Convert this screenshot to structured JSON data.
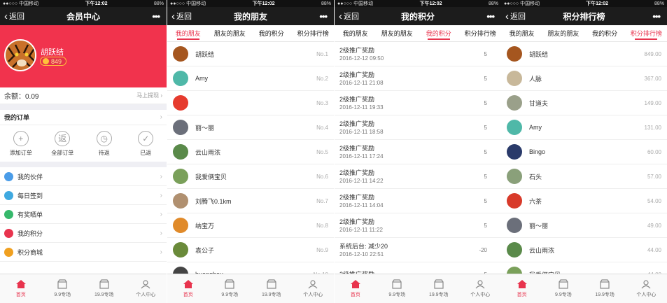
{
  "status": {
    "carrier": "●●○○○ 中国移动",
    "time": "下午12:02",
    "battery": "88%"
  },
  "common": {
    "back": "返回",
    "more": "•••"
  },
  "tabs": [
    "我的朋友",
    "朋友的朋友",
    "我的积分",
    "积分排行榜"
  ],
  "tabbar": [
    "首页",
    "9.9专场",
    "19.9专场",
    "个人中心"
  ],
  "accent": "#e8344e",
  "screen1": {
    "title": "会员中心",
    "name": "胡跃结",
    "points": "849",
    "balance_label": "余额：0.09",
    "withdraw": "马上提现",
    "orders_title": "我的订单",
    "order_actions": [
      "添加订单",
      "全部订单",
      "待返",
      "已返"
    ],
    "menu": [
      {
        "label": "我的伙伴",
        "color": "#4a9ce8"
      },
      {
        "label": "每日签到",
        "color": "#3fa9e0"
      },
      {
        "label": "有奖晒单",
        "color": "#36b86b"
      },
      {
        "label": "我的积分",
        "color": "#e8344e"
      },
      {
        "label": "积分商城",
        "color": "#f0a020"
      }
    ]
  },
  "screen2": {
    "title": "我的朋友",
    "friends": [
      {
        "name": "胡跃结",
        "rank": "No.1",
        "color": "#a5561f"
      },
      {
        "name": "Amy",
        "rank": "No.2",
        "color": "#4fb8a8"
      },
      {
        "name": "",
        "rank": "No.3",
        "color": "#e63b2e"
      },
      {
        "name": "丽～丽",
        "rank": "No.4",
        "color": "#6b6f7a"
      },
      {
        "name": "云山雨浓",
        "rank": "No.5",
        "color": "#5a8a4a"
      },
      {
        "name": "我爱俩宝贝",
        "rank": "No.6",
        "color": "#7aa05a"
      },
      {
        "name": "刘腾飞0.1km",
        "rank": "No.7",
        "color": "#b09070"
      },
      {
        "name": "纳宝万",
        "rank": "No.8",
        "color": "#e08a2a"
      },
      {
        "name": "袁公子",
        "rank": "No.9",
        "color": "#6a8a3a"
      },
      {
        "name": "huanghou",
        "rank": "No.10",
        "color": "#444444"
      }
    ]
  },
  "screen3": {
    "title": "我的积分",
    "records": [
      {
        "title": "2级推广奖励",
        "date": "2016-12-12 09:50",
        "value": "5"
      },
      {
        "title": "2级推广奖励",
        "date": "2016-12-11 21:08",
        "value": "5"
      },
      {
        "title": "2级推广奖励",
        "date": "2016-12-11 19:33",
        "value": "5"
      },
      {
        "title": "2级推广奖励",
        "date": "2016-12-11 18:58",
        "value": "5"
      },
      {
        "title": "2级推广奖励",
        "date": "2016-12-11 17:24",
        "value": "5"
      },
      {
        "title": "2级推广奖励",
        "date": "2016-12-11 14:22",
        "value": "5"
      },
      {
        "title": "2级推广奖励",
        "date": "2016-12-11 14:04",
        "value": "5"
      },
      {
        "title": "2级推广奖励",
        "date": "2016-12-11 11:22",
        "value": "5"
      },
      {
        "title": "系统后台: 减少20",
        "date": "2016-12-10 22:51",
        "value": "-20"
      },
      {
        "title": "2级推广奖励",
        "date": "",
        "value": "5"
      }
    ]
  },
  "screen4": {
    "title": "积分排行榜",
    "ranking": [
      {
        "name": "胡跃结",
        "score": "849.00",
        "color": "#a5561f"
      },
      {
        "name": "人脉",
        "score": "367.00",
        "color": "#c8b89a"
      },
      {
        "name": "甘道夫",
        "score": "149.00",
        "color": "#9aa08a"
      },
      {
        "name": "Amy",
        "score": "131.00",
        "color": "#4fb8a8"
      },
      {
        "name": "Bingo",
        "score": "60.00",
        "color": "#2a3a6a"
      },
      {
        "name": "石头",
        "score": "57.00",
        "color": "#8aa07a"
      },
      {
        "name": "六茶",
        "score": "54.00",
        "color": "#d83a2a"
      },
      {
        "name": "丽～丽",
        "score": "49.00",
        "color": "#6b6f7a"
      },
      {
        "name": "云山雨浓",
        "score": "44.00",
        "color": "#5a8a4a"
      },
      {
        "name": "我爱俩宝贝",
        "score": "44.00",
        "color": "#7aa05a"
      }
    ]
  }
}
